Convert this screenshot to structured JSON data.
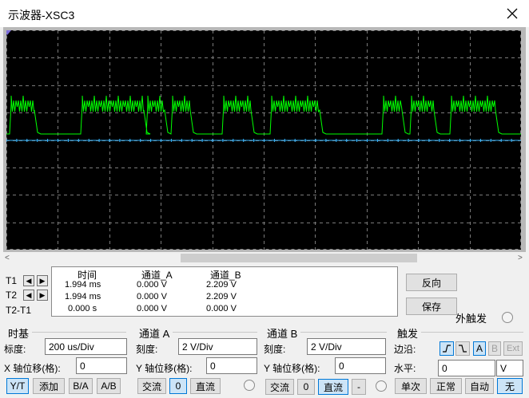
{
  "window": {
    "title": "示波器-XSC3",
    "close_icon": "close-icon"
  },
  "colors": {
    "trace_a": "#00ff00",
    "trace_b": "#36b6ff",
    "screen_bg": "#000000",
    "grid": "#7a7a7a"
  },
  "cursors": {
    "t1": "T1",
    "t2": "T2",
    "t2_t1": "T2-T1"
  },
  "readout": {
    "headers": {
      "time": "时间",
      "channel_a": "通道_A",
      "channel_b": "通道_B"
    },
    "rows": [
      {
        "time": "1.994 ms",
        "a": "0.000 V",
        "b": "2.209 V"
      },
      {
        "time": "1.994 ms",
        "a": "0.000 V",
        "b": "2.209 V"
      },
      {
        "time": "0.000 s",
        "a": "0.000 V",
        "b": "0.000 V"
      }
    ]
  },
  "actions": {
    "reverse": "反向",
    "save": "保存",
    "ext_trigger": "外触发"
  },
  "timebase": {
    "title": "时基",
    "scale_label": "标度:",
    "scale_value": "200 us/Div",
    "xpos_label": "X 轴位移(格):",
    "xpos_value": "0",
    "modes": [
      "Y/T",
      "添加",
      "B/A",
      "A/B"
    ]
  },
  "channel_a": {
    "title": "通道 A",
    "scale_label": "刻度:",
    "scale_value": "2  V/Div",
    "ypos_label": "Y 轴位移(格):",
    "ypos_value": "0",
    "coupling": [
      "交流",
      "0",
      "直流"
    ]
  },
  "channel_b": {
    "title": "通道 B",
    "scale_label": "刻度:",
    "scale_value": "2  V/Div",
    "ypos_label": "Y 轴位移(格):",
    "ypos_value": "0",
    "coupling": [
      "交流",
      "0",
      "直流",
      "-"
    ]
  },
  "trigger": {
    "title": "触发",
    "edge_label": "边沿:",
    "sources": [
      "A",
      "B",
      "Ext"
    ],
    "level_label": "水平:",
    "level_value": "0",
    "level_unit": "V",
    "modes": [
      "单次",
      "正常",
      "自动",
      "无"
    ]
  }
}
